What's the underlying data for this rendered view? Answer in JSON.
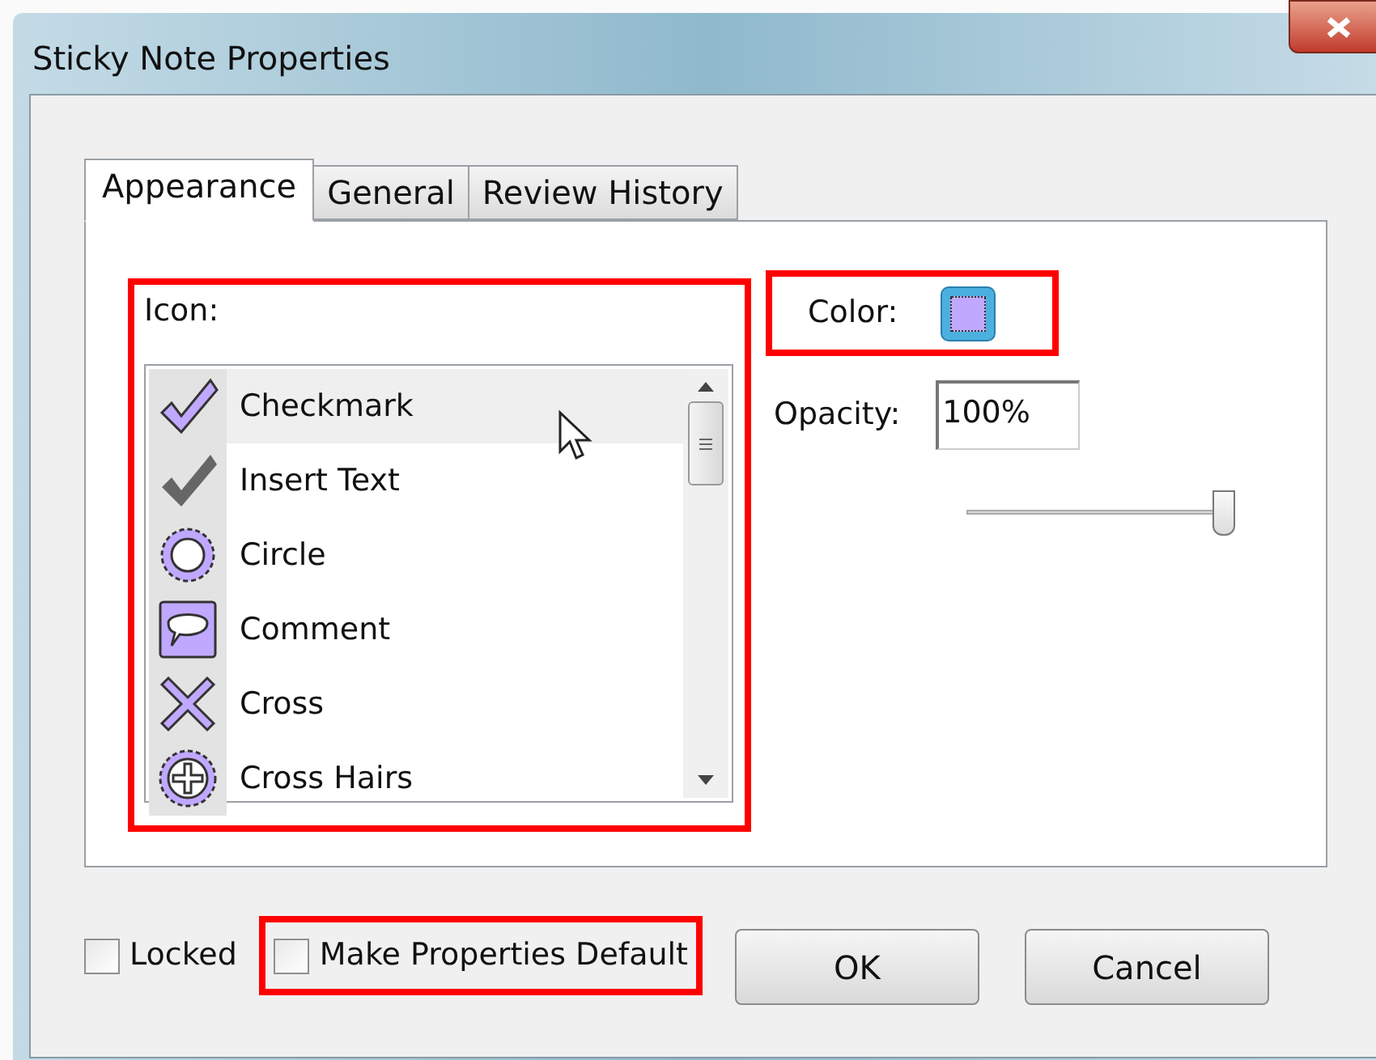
{
  "window": {
    "title": "Sticky Note Properties"
  },
  "tabs": [
    {
      "label": "Appearance",
      "selected": true
    },
    {
      "label": "General",
      "selected": false
    },
    {
      "label": "Review History",
      "selected": false
    }
  ],
  "icon_list": {
    "label": "Icon:",
    "items": [
      {
        "label": "Checkmark",
        "kind": "checkmark",
        "selected": true
      },
      {
        "label": "Insert Text",
        "kind": "insert-text",
        "selected": false
      },
      {
        "label": "Circle",
        "kind": "circle",
        "selected": false
      },
      {
        "label": "Comment",
        "kind": "comment",
        "selected": false
      },
      {
        "label": "Cross",
        "kind": "cross",
        "selected": false
      },
      {
        "label": "Cross Hairs",
        "kind": "cross-hairs",
        "selected": false
      }
    ]
  },
  "color": {
    "label": "Color:",
    "color": "#c0a8ff"
  },
  "opacity": {
    "label": "Opacity:",
    "value": "100%",
    "level": 1
  },
  "checkboxes": [
    {
      "label": "Locked",
      "checked": false,
      "highlighted": false
    },
    {
      "label": "Make Properties Default",
      "checked": false,
      "highlighted": true
    }
  ],
  "buttons": [
    "OK",
    "Cancel"
  ]
}
